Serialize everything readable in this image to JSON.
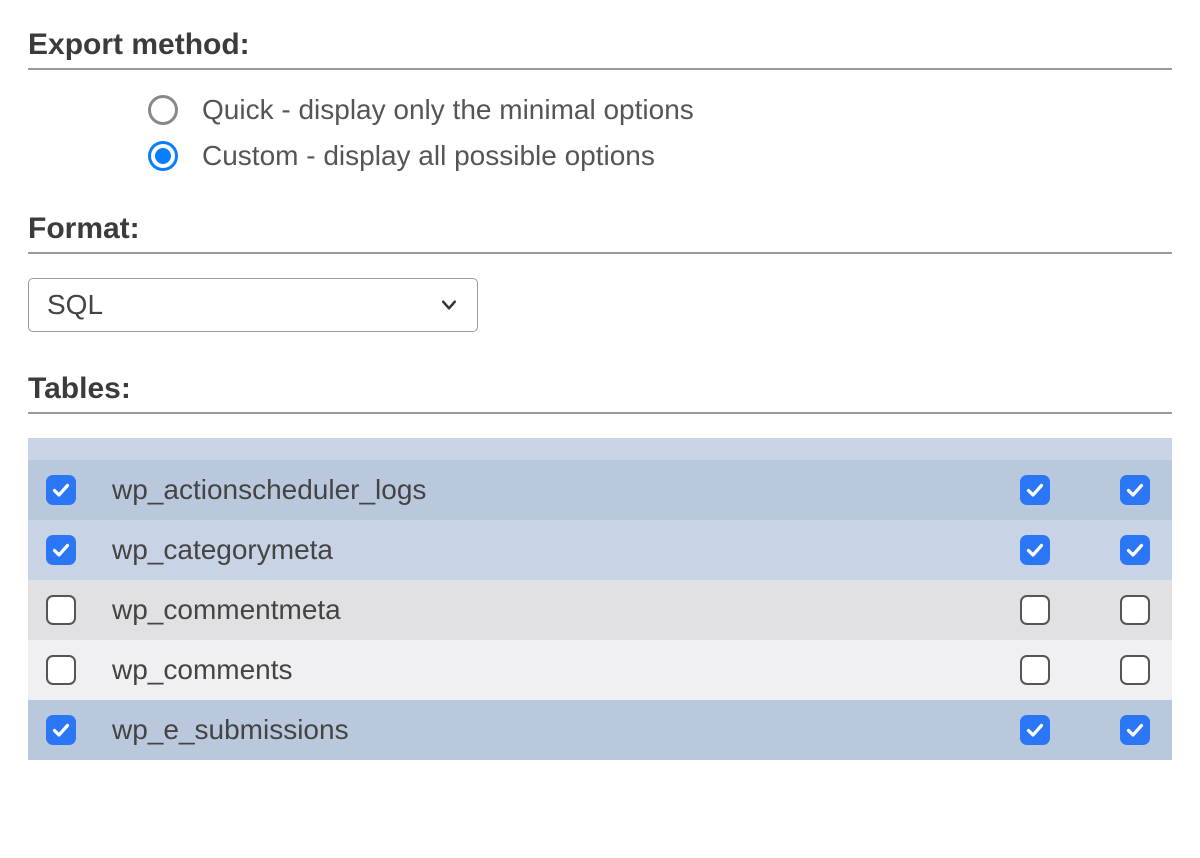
{
  "export_method": {
    "heading": "Export method:",
    "options": [
      {
        "label": "Quick - display only the minimal options",
        "selected": false
      },
      {
        "label": "Custom - display all possible options",
        "selected": true
      }
    ]
  },
  "format": {
    "heading": "Format:",
    "selected": "SQL"
  },
  "tables": {
    "heading": "Tables:",
    "rows": [
      {
        "name": "wp_actionscheduler_logs",
        "c1": true,
        "c2": true,
        "c3": true,
        "shade": "blue-a"
      },
      {
        "name": "wp_categorymeta",
        "c1": true,
        "c2": true,
        "c3": true,
        "shade": "blue-b"
      },
      {
        "name": "wp_commentmeta",
        "c1": false,
        "c2": false,
        "c3": false,
        "shade": "grey-a"
      },
      {
        "name": "wp_comments",
        "c1": false,
        "c2": false,
        "c3": false,
        "shade": "grey-b"
      },
      {
        "name": "wp_e_submissions",
        "c1": true,
        "c2": true,
        "c3": true,
        "shade": "blue-a"
      }
    ]
  }
}
